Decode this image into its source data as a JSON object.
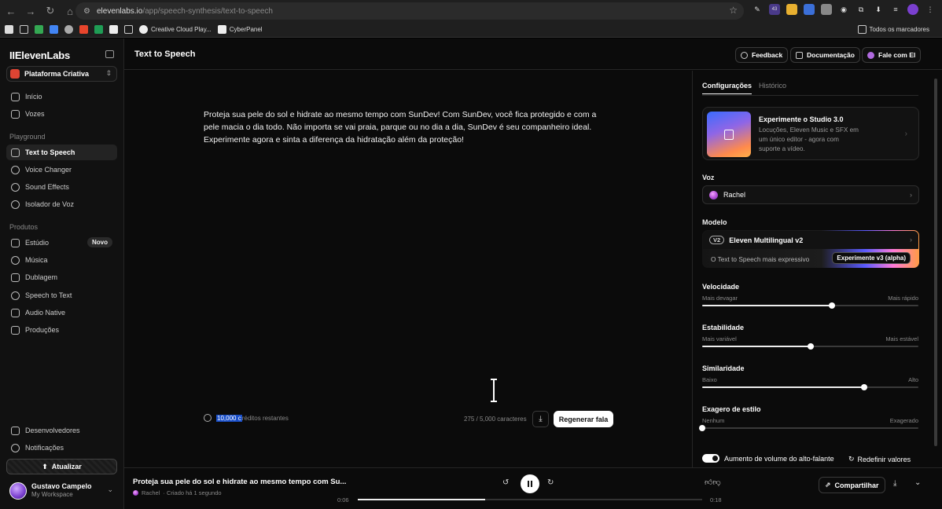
{
  "browser": {
    "url_host": "elevenlabs.io",
    "url_path": "/app/speech-synthesis/text-to-speech",
    "ext_badge": "43",
    "bookmarks": [
      "Creative Cloud Play...",
      "CyberPanel"
    ],
    "bookmarks_all": "Todos os marcadores"
  },
  "sidebar": {
    "logo": "IIElevenLabs",
    "workspace": "Plataforma Criativa",
    "top_items": [
      {
        "label": "Início",
        "icon": "home-icon"
      },
      {
        "label": "Vozes",
        "icon": "voices-icon"
      }
    ],
    "playground_title": "Playground",
    "playground_items": [
      {
        "label": "Text to Speech",
        "icon": "tts-icon"
      },
      {
        "label": "Voice Changer",
        "icon": "voice-changer-icon"
      },
      {
        "label": "Sound Effects",
        "icon": "sound-effects-icon"
      },
      {
        "label": "Isolador de Voz",
        "icon": "voice-isolator-icon"
      }
    ],
    "products_title": "Produtos",
    "product_items": [
      {
        "label": "Estúdio",
        "icon": "studio-icon",
        "badge": "Novo"
      },
      {
        "label": "Música",
        "icon": "music-icon"
      },
      {
        "label": "Dublagem",
        "icon": "dubbing-icon"
      },
      {
        "label": "Speech to Text",
        "icon": "stt-icon"
      },
      {
        "label": "Audio Native",
        "icon": "audio-native-icon"
      },
      {
        "label": "Produções",
        "icon": "productions-icon"
      }
    ],
    "bottom_items": [
      {
        "label": "Desenvolvedores",
        "icon": "developers-icon"
      },
      {
        "label": "Notificações",
        "icon": "bell-icon"
      }
    ],
    "upgrade": "Atualizar",
    "user_name": "Gustavo Campelo",
    "user_workspace": "My Workspace"
  },
  "header": {
    "title": "Text to Speech",
    "feedback": "Feedback",
    "docs": "Documentação",
    "talk": "Fale com El"
  },
  "editor": {
    "text": "Proteja sua pele do sol e hidrate ao mesmo tempo com SunDev! Com SunDev, você fica protegido e com a pele macia o dia todo. Não importa se vai praia, parque ou no dia a dia, SunDev é seu companheiro ideal. Experimente agora e sinta a diferença da hidratação além da proteção!",
    "credits_value": "10,000 c",
    "credits_rest": "réditos restantes",
    "char_count": "275 / 5,000 caracteres",
    "regen": "Regenerar fala"
  },
  "panel": {
    "tab_settings": "Configurações",
    "tab_history": "Histórico",
    "promo_title": "Experimente o Studio 3.0",
    "promo_desc": "Locuções, Eleven Music e SFX em um único editor - agora com suporte a vídeo.",
    "voice_label": "Voz",
    "voice_name": "Rachel",
    "model_label": "Modelo",
    "model_tag": "V2",
    "model_name": "Eleven Multilingual v2",
    "model_sub": "O Text to Speech mais expressivo",
    "model_cta": "Experimente v3 (alpha)",
    "sliders": [
      {
        "label": "Velocidade",
        "min": "Mais devagar",
        "max": "Mais rápido",
        "value": 0.6
      },
      {
        "label": "Estabilidade",
        "min": "Mais variável",
        "max": "Mais estável",
        "value": 0.5
      },
      {
        "label": "Similaridade",
        "min": "Baixo",
        "max": "Alto",
        "value": 0.75
      },
      {
        "label": "Exagero de estilo",
        "min": "Nenhum",
        "max": "Exagerado",
        "value": 0.0
      }
    ],
    "toggle_label": "Aumento de volume do alto-falante",
    "reset": "Redefinir valores"
  },
  "player": {
    "title": "Proteja sua pele do sol e hidrate ao mesmo tempo com Su...",
    "voice": "Rachel",
    "created": "· Criado há 1 segundo",
    "current": "0:06",
    "total": "0:18",
    "progress": 0.37,
    "share": "Compartilhar"
  }
}
